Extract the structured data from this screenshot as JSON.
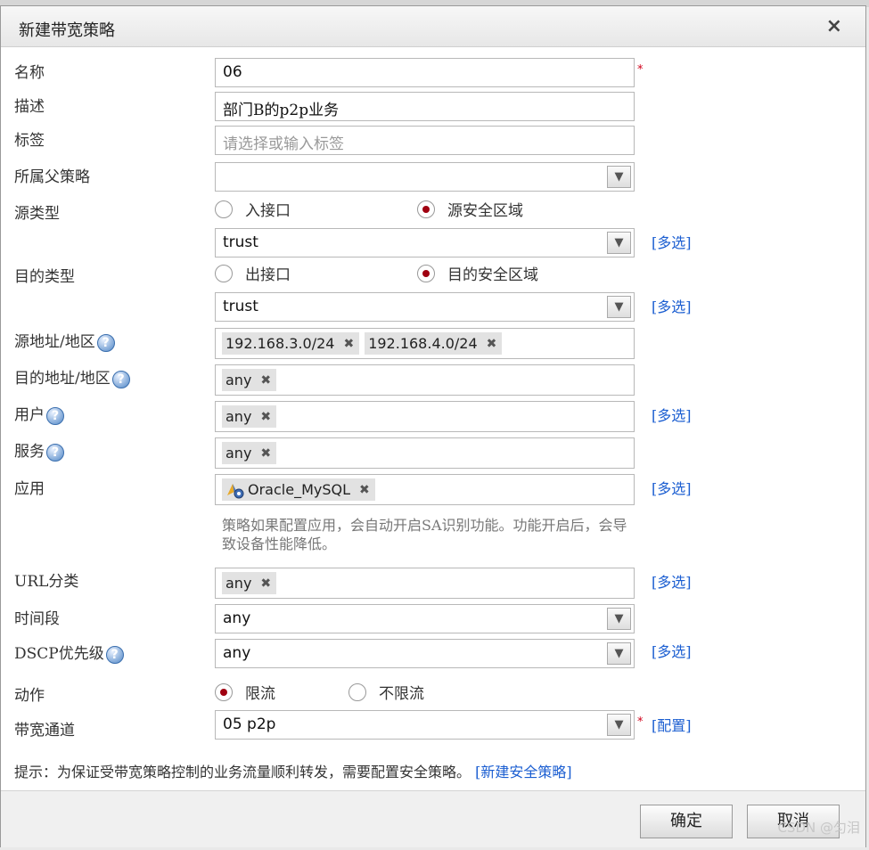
{
  "dialog": {
    "title": "新建带宽策略",
    "close": "×"
  },
  "fields": {
    "name": {
      "label": "名称",
      "value": "06",
      "required": "*"
    },
    "desc": {
      "label": "描述",
      "value": "部门B的p2p业务"
    },
    "tag": {
      "label": "标签",
      "placeholder": "请选择或输入标签"
    },
    "parent": {
      "label": "所属父策略",
      "value": ""
    },
    "src_type": {
      "label": "源类型",
      "options": [
        "入接口",
        "源安全区域"
      ],
      "selected": "源安全区域",
      "zone": "trust",
      "multi": "[多选]"
    },
    "dst_type": {
      "label": "目的类型",
      "options": [
        "出接口",
        "目的安全区域"
      ],
      "selected": "目的安全区域",
      "zone": "trust",
      "multi": "[多选]"
    },
    "src_addr": {
      "label": "源地址/地区",
      "tags": [
        "192.168.3.0/24",
        "192.168.4.0/24"
      ]
    },
    "dst_addr": {
      "label": "目的地址/地区",
      "tags": [
        "any"
      ]
    },
    "user": {
      "label": "用户",
      "tags": [
        "any"
      ],
      "multi": "[多选]"
    },
    "service": {
      "label": "服务",
      "tags": [
        "any"
      ]
    },
    "app": {
      "label": "应用",
      "tags": [
        "Oracle_MySQL"
      ],
      "multi": "[多选]",
      "hint": "策略如果配置应用，会自动开启SA识别功能。功能开启后，会导致设备性能降低。"
    },
    "url": {
      "label": "URL分类",
      "tags": [
        "any"
      ],
      "multi": "[多选]"
    },
    "time": {
      "label": "时间段",
      "value": "any"
    },
    "dscp": {
      "label": "DSCP优先级",
      "value": "any",
      "multi": "[多选]"
    },
    "action": {
      "label": "动作",
      "options": [
        "限流",
        "不限流"
      ],
      "selected": "限流"
    },
    "channel": {
      "label": "带宽通道",
      "value": "05 p2p",
      "required": "*",
      "config": "[配置]"
    }
  },
  "notice": {
    "text": "提示：为保证受带宽策略控制的业务流量顺利转发，需要配置安全策略。",
    "link": "[新建安全策略]"
  },
  "buttons": {
    "ok": "确定",
    "cancel": "取消"
  },
  "watermark": "CSDN @匀泪",
  "help_glyph": "?",
  "tag_remove_glyph": "✖",
  "dropdown_glyph": "▼",
  "icons": {
    "help": "help-circle-icon",
    "dropdown": "chevron-down-icon",
    "remove": "close-icon",
    "app": "application-icon"
  },
  "colors": {
    "link": "#1b5ed1",
    "required": "#d0001a",
    "radio_selected": "#a00010"
  }
}
